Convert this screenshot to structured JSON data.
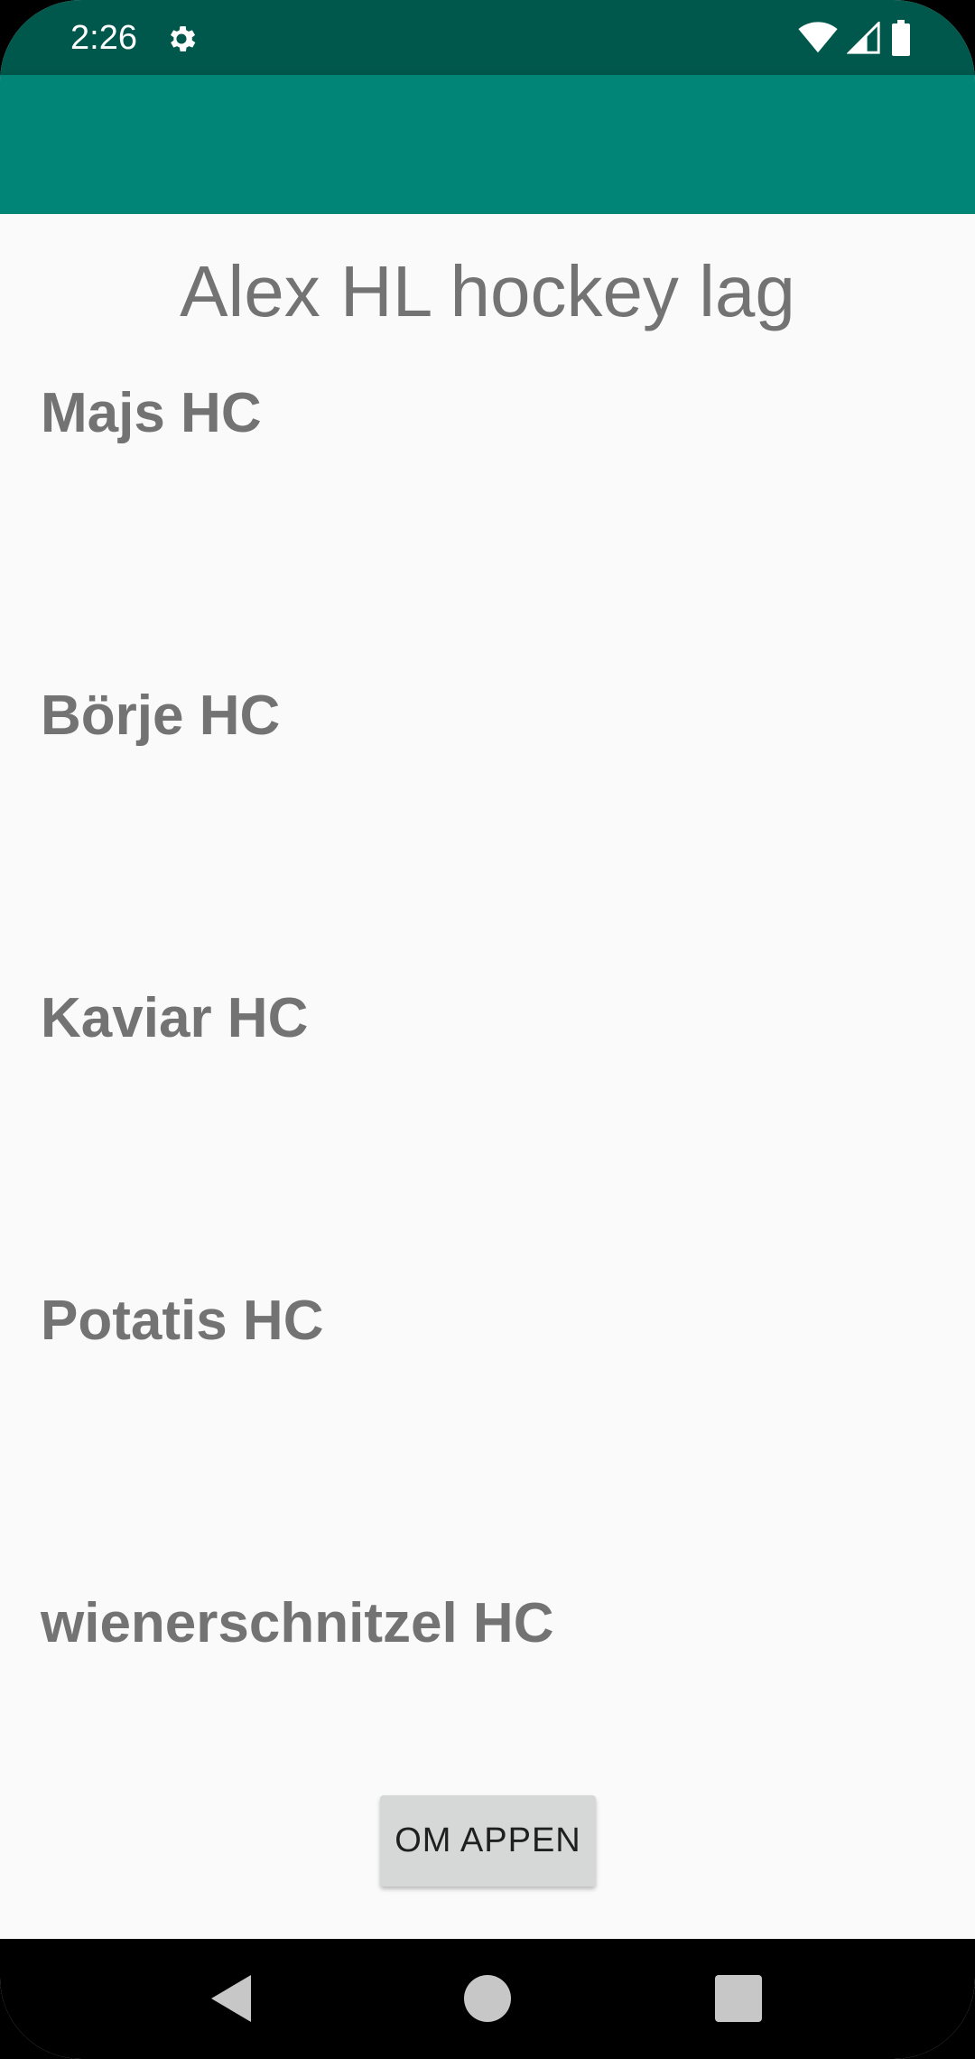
{
  "status_bar": {
    "time": "2:26",
    "icons": [
      "gear-icon",
      "wifi-icon",
      "signal-icon",
      "battery-icon"
    ],
    "background": "#00574b"
  },
  "app_bar": {
    "background": "#008577"
  },
  "main": {
    "title": "Alex HL hockey lag",
    "teams": [
      "Majs HC",
      "Börje HC",
      "Kaviar HC",
      "Potatis HC",
      "wienerschnitzel HC"
    ],
    "about_button_label": "OM APPEN"
  },
  "nav_bar": {
    "buttons": [
      "back-icon",
      "home-icon",
      "recents-icon"
    ]
  }
}
